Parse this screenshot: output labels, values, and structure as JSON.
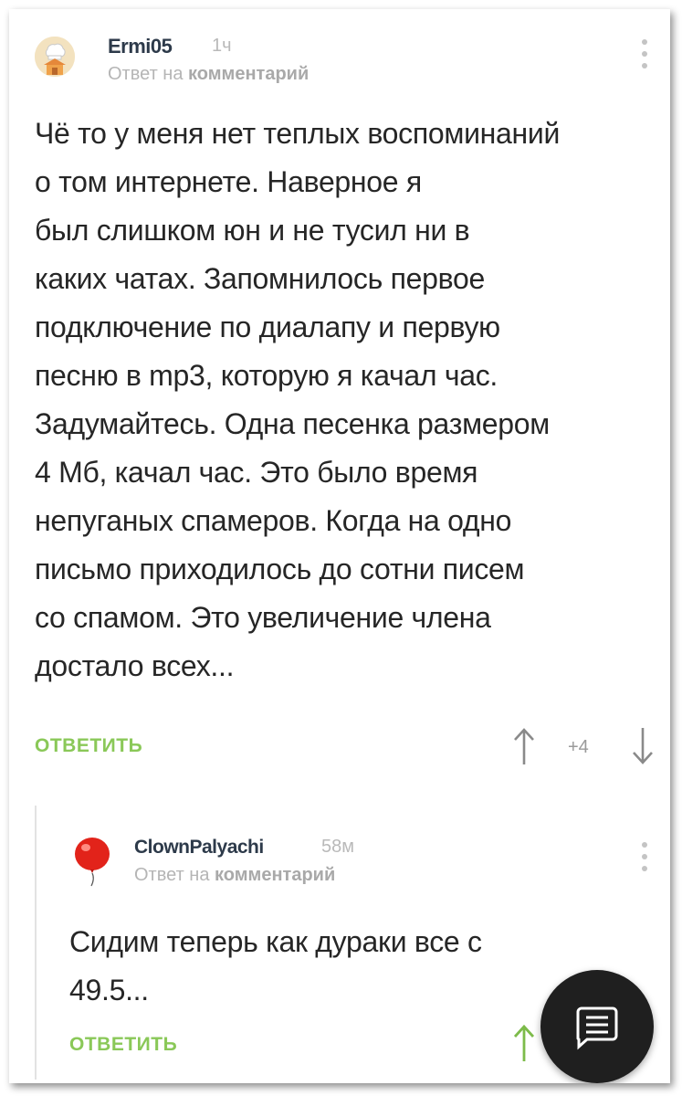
{
  "comments": [
    {
      "author": "Ermi05",
      "time": "1ч",
      "reply_prefix": "Ответ на",
      "reply_target": "комментарий",
      "lines": [
        "Чё то у меня нет теплых воспоминаний",
        "о том интернете. Наверное я",
        "был слишком юн и не тусил ни в",
        "каких чатах. Запомнилось первое",
        "подключение по диалапу и первую",
        "песню в mp3, которую я качал час.",
        "Задумайтесь. Одна песенка размером",
        "4 Мб, качал час. Это было время",
        "непуганых спамеров. Когда на одно",
        "письмо приходилось до сотни писем",
        "со спамом. Это увеличение члена",
        "достало всех..."
      ],
      "reply_label": "ОТВЕТИТЬ",
      "rating": "+4"
    },
    {
      "author": "ClownPalyachi",
      "time": "58м",
      "reply_prefix": "Ответ на",
      "reply_target": "комментарий",
      "lines": [
        "Сидим теперь как дураки все с",
        "49.5..."
      ],
      "reply_label": "ОТВЕТИТЬ"
    }
  ],
  "colors": {
    "accent_green": "#8ac858",
    "text": "#262626",
    "muted": "#b5b5b5",
    "fab": "#1f1f1f"
  },
  "icons": {
    "avatar1": "chef-house-avatar",
    "avatar2": "red-balloon-avatar",
    "menu": "kebab-menu-icon",
    "up": "arrow-up-icon",
    "down": "arrow-down-icon",
    "fab": "comment-icon"
  }
}
